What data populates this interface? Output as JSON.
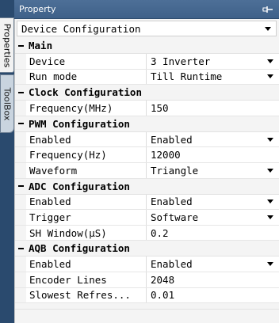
{
  "titlebar": {
    "title": "Property",
    "pin_icon": "pin-icon"
  },
  "side_tabs": [
    {
      "label": "Properties",
      "active": true
    },
    {
      "label": "ToolBox",
      "active": false
    }
  ],
  "selector": {
    "value": "Device Configuration"
  },
  "categories": [
    {
      "label": "Main",
      "rows": [
        {
          "name": "Device",
          "value": "3 Inverter",
          "dropdown": true
        },
        {
          "name": "Run mode",
          "value": "Till Runtime",
          "dropdown": true
        }
      ]
    },
    {
      "label": "Clock Configuration",
      "rows": [
        {
          "name": "Frequency(MHz)",
          "value": "150",
          "dropdown": false
        }
      ]
    },
    {
      "label": "PWM Configuration",
      "rows": [
        {
          "name": "Enabled",
          "value": "Enabled",
          "dropdown": true
        },
        {
          "name": "Frequency(Hz)",
          "value": "12000",
          "dropdown": false
        },
        {
          "name": "Waveform",
          "value": "Triangle",
          "dropdown": true
        }
      ]
    },
    {
      "label": "ADC Configuration",
      "rows": [
        {
          "name": "Enabled",
          "value": "Enabled",
          "dropdown": true
        },
        {
          "name": "Trigger",
          "value": "Software",
          "dropdown": true
        },
        {
          "name": "SH Window(µS)",
          "value": "0.2",
          "dropdown": false
        }
      ]
    },
    {
      "label": "AQB Configuration",
      "rows": [
        {
          "name": "Enabled",
          "value": "Enabled",
          "dropdown": true
        },
        {
          "name": "Encoder Lines",
          "value": "2048",
          "dropdown": false
        },
        {
          "name": "Slowest Refres...",
          "value": "0.01",
          "dropdown": false
        }
      ]
    }
  ],
  "colors": {
    "titlebar": "#3f6189",
    "background": "#1e3a5f",
    "panel": "#f4f4f4"
  }
}
